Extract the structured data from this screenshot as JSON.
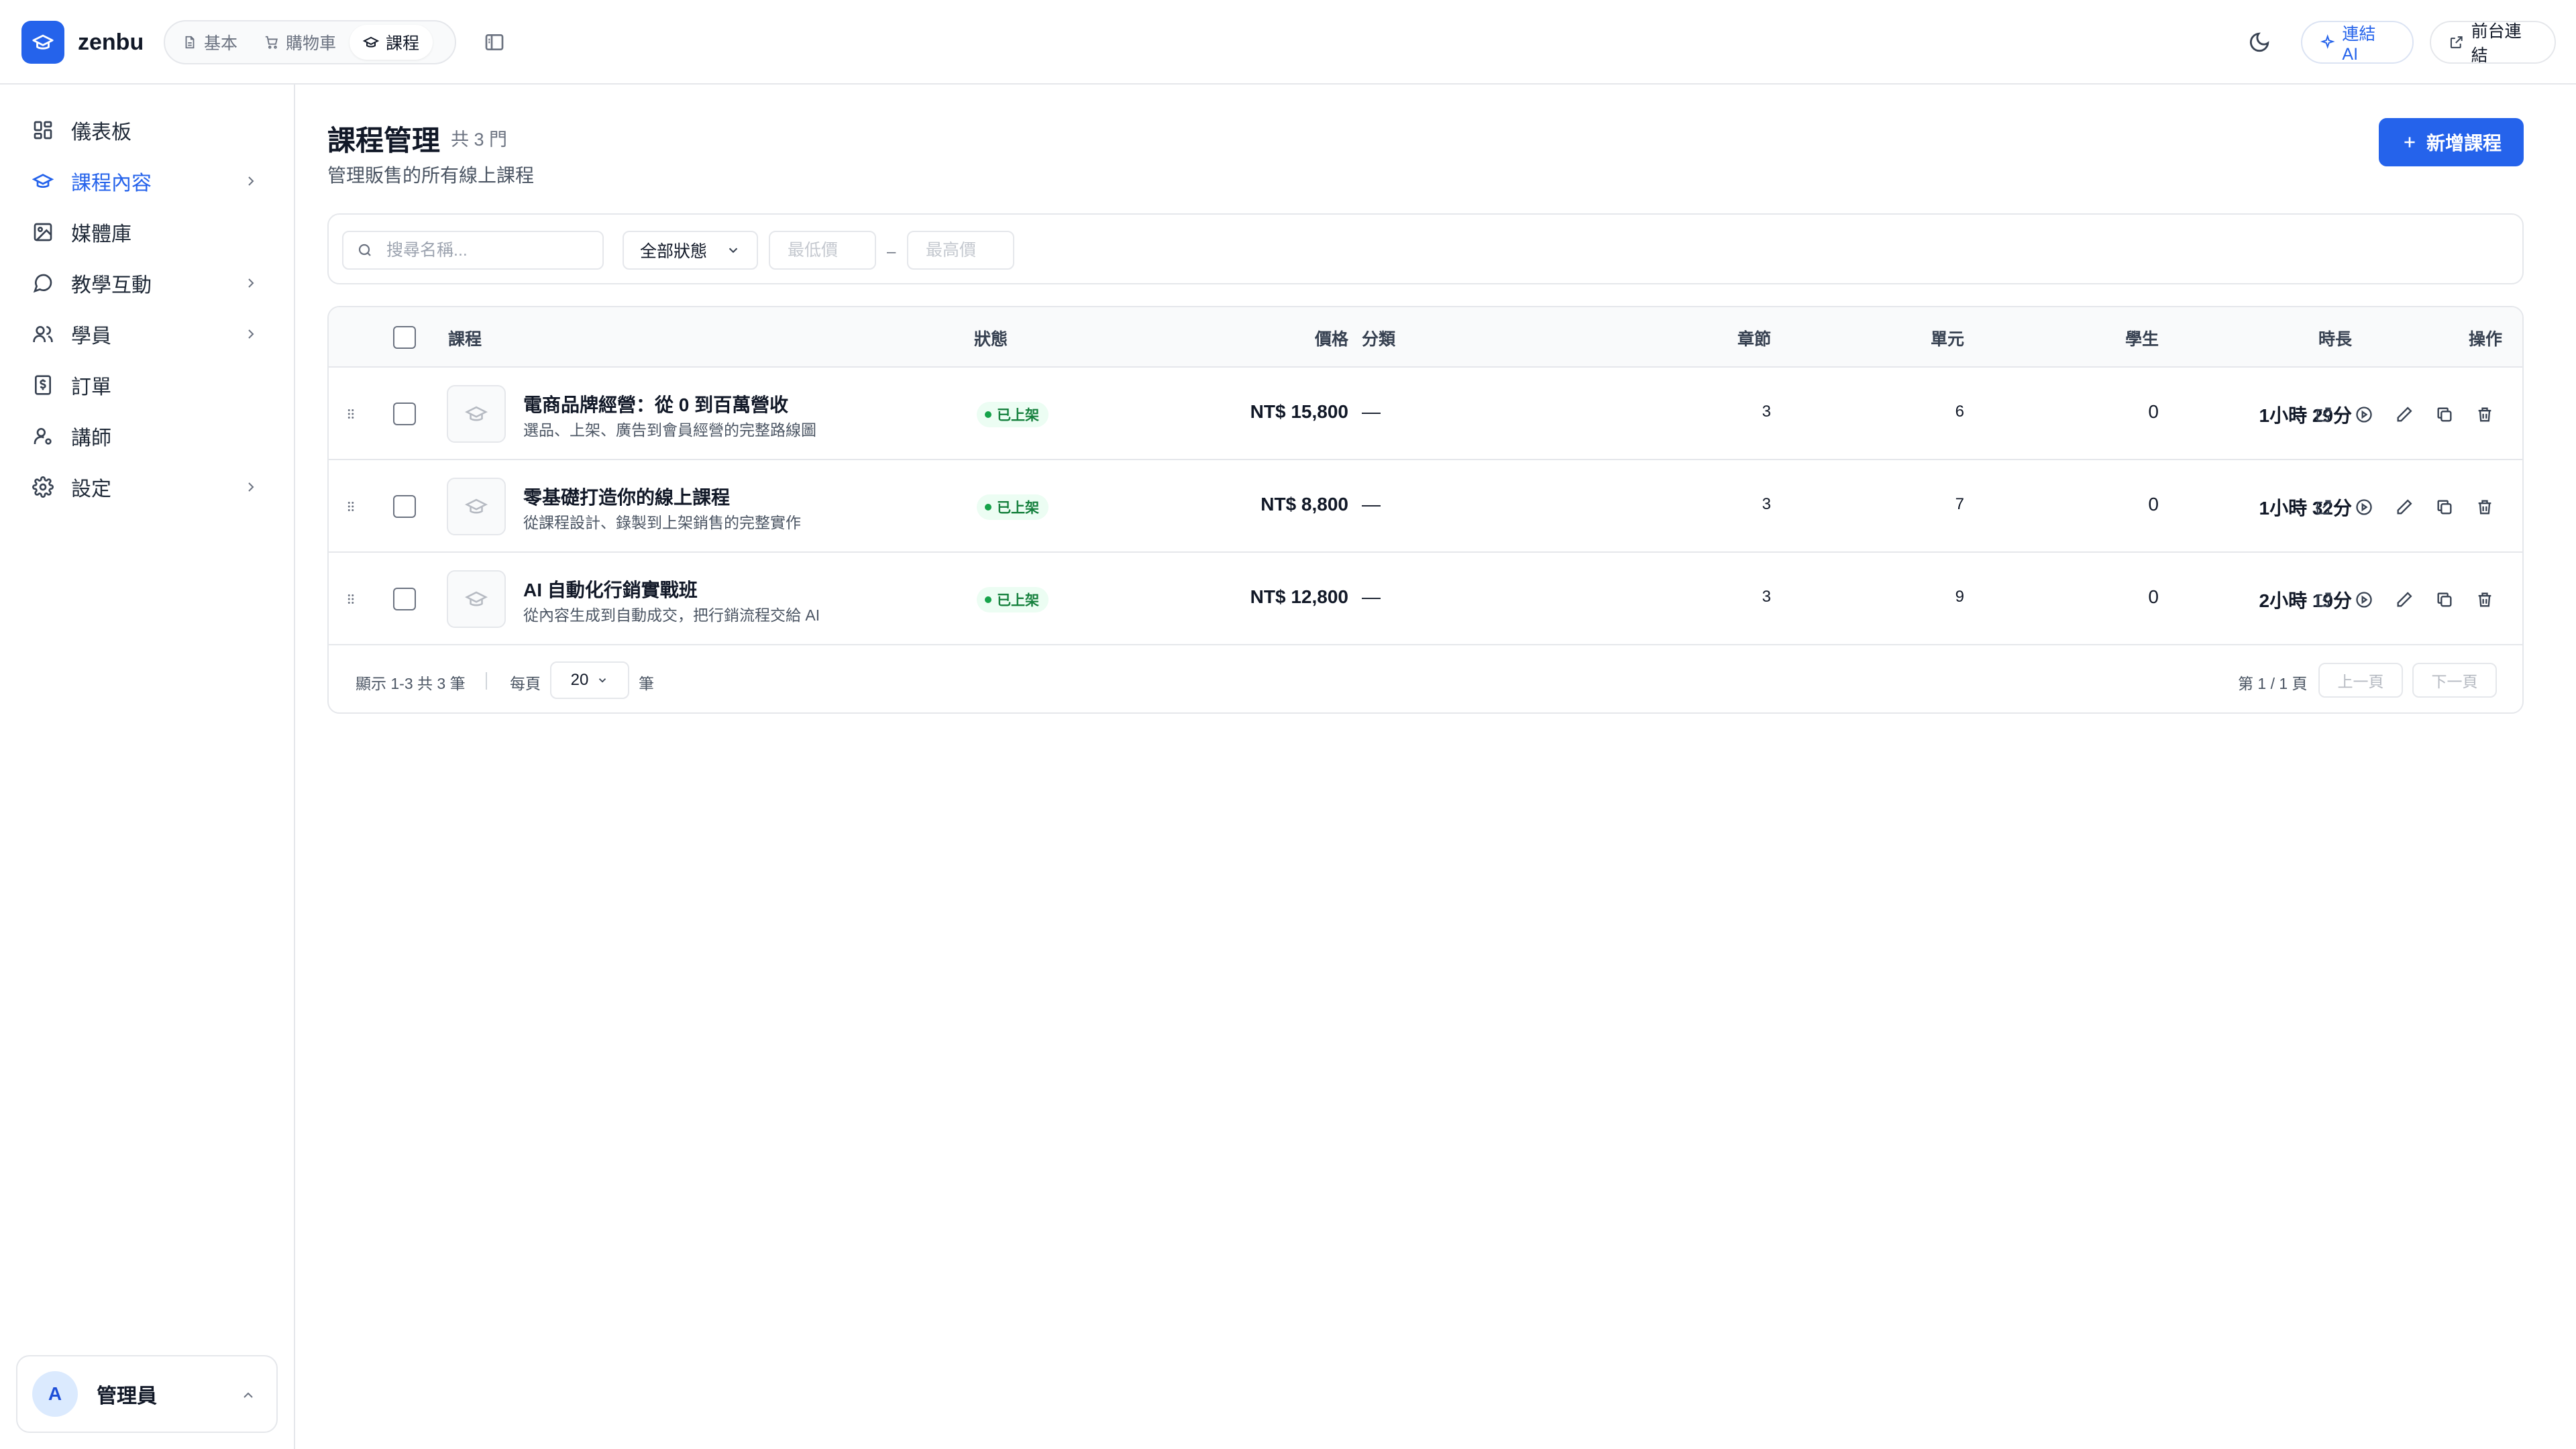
{
  "app": {
    "brand": "zenbu",
    "plugin_tabs": [
      {
        "label": "基本",
        "icon": "document-icon"
      },
      {
        "label": "購物車",
        "icon": "cart-icon"
      },
      {
        "label": "課程",
        "icon": "graduation-cap-icon",
        "active": true
      }
    ],
    "ai_button": "連結 AI",
    "front_button": "前台連結"
  },
  "sidebar": {
    "items": [
      {
        "label": "儀表板",
        "icon": "dashboard-icon"
      },
      {
        "label": "課程內容",
        "icon": "graduation-cap-icon",
        "active": true,
        "has_children": true
      },
      {
        "label": "媒體庫",
        "icon": "image-icon"
      },
      {
        "label": "教學互動",
        "icon": "chat-icon",
        "has_children": true
      },
      {
        "label": "學員",
        "icon": "users-icon",
        "has_children": true
      },
      {
        "label": "訂單",
        "icon": "receipt-icon"
      },
      {
        "label": "講師",
        "icon": "user-cog-icon"
      },
      {
        "label": "設定",
        "icon": "gear-icon",
        "has_children": true
      }
    ],
    "user": {
      "initial": "A",
      "name": "管理員"
    }
  },
  "page": {
    "title": "課程管理",
    "count": "共 3 門",
    "subtitle": "管理販售的所有線上課程",
    "new_button": "新增課程"
  },
  "filters": {
    "search_placeholder": "搜尋名稱...",
    "status_selected": "全部狀態",
    "min_price_placeholder": "最低價",
    "max_price_placeholder": "最高價",
    "range_dash": "–"
  },
  "table": {
    "headers": {
      "course": "課程",
      "status": "狀態",
      "price": "價格",
      "category": "分類",
      "chapters": "章節",
      "units": "單元",
      "students": "學生",
      "duration": "時長",
      "actions": "操作"
    },
    "rows": [
      {
        "title": "電商品牌經營：從 0 到百萬營收",
        "desc": "選品、上架、廣告到會員經營的完整路線圖",
        "status": "已上架",
        "price": "NT$ 15,800",
        "category": "—",
        "chapters": "3",
        "units": "6",
        "students": "0",
        "duration": "1小時 29分"
      },
      {
        "title": "零基礎打造你的線上課程",
        "desc": "從課程設計、錄製到上架銷售的完整實作",
        "status": "已上架",
        "price": "NT$ 8,800",
        "category": "—",
        "chapters": "3",
        "units": "7",
        "students": "0",
        "duration": "1小時 32分"
      },
      {
        "title": "AI 自動化行銷實戰班",
        "desc": "從內容生成到自動成交，把行銷流程交給 AI",
        "status": "已上架",
        "price": "NT$ 12,800",
        "category": "—",
        "chapters": "3",
        "units": "9",
        "students": "0",
        "duration": "2小時 19分"
      }
    ],
    "footer": {
      "showing": "顯示 1-3 共 3 筆",
      "per_page_label": "每頁",
      "per_page_value": "20",
      "per_page_unit": "筆",
      "page_info": "第 1 / 1 頁",
      "prev": "上一頁",
      "next": "下一頁"
    }
  },
  "colors": {
    "accent": "#2563eb",
    "status_green": "#16a34a",
    "status_bg": "#ecfdf3",
    "border": "#e5e7eb"
  }
}
